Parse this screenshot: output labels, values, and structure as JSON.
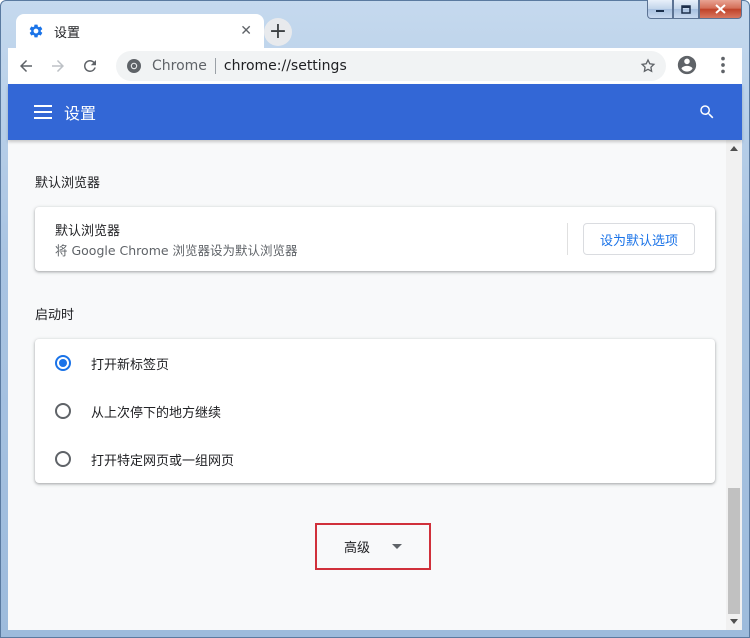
{
  "window": {
    "minimize_icon": "minimize-icon",
    "maximize_icon": "maximize-icon",
    "close_icon": "close-icon"
  },
  "tab": {
    "title": "设置",
    "close_glyph": "✕",
    "new_tab_glyph": "+"
  },
  "omnibox": {
    "chip": "Chrome",
    "url": "chrome://settings"
  },
  "header": {
    "title": "设置"
  },
  "sections": {
    "default_browser": {
      "title": "默认浏览器",
      "row_title": "默认浏览器",
      "row_subtitle": "将 Google Chrome 浏览器设为默认浏览器",
      "button_label": "设为默认选项"
    },
    "startup": {
      "title": "启动时",
      "options": [
        {
          "label": "打开新标签页",
          "checked": true
        },
        {
          "label": "从上次停下的地方继续",
          "checked": false
        },
        {
          "label": "打开特定网页或一组网页",
          "checked": false
        }
      ]
    }
  },
  "advanced": {
    "label": "高级"
  },
  "colors": {
    "header_blue": "#3367d6",
    "accent_blue": "#1a73e8",
    "highlight_red": "#d0303a"
  }
}
